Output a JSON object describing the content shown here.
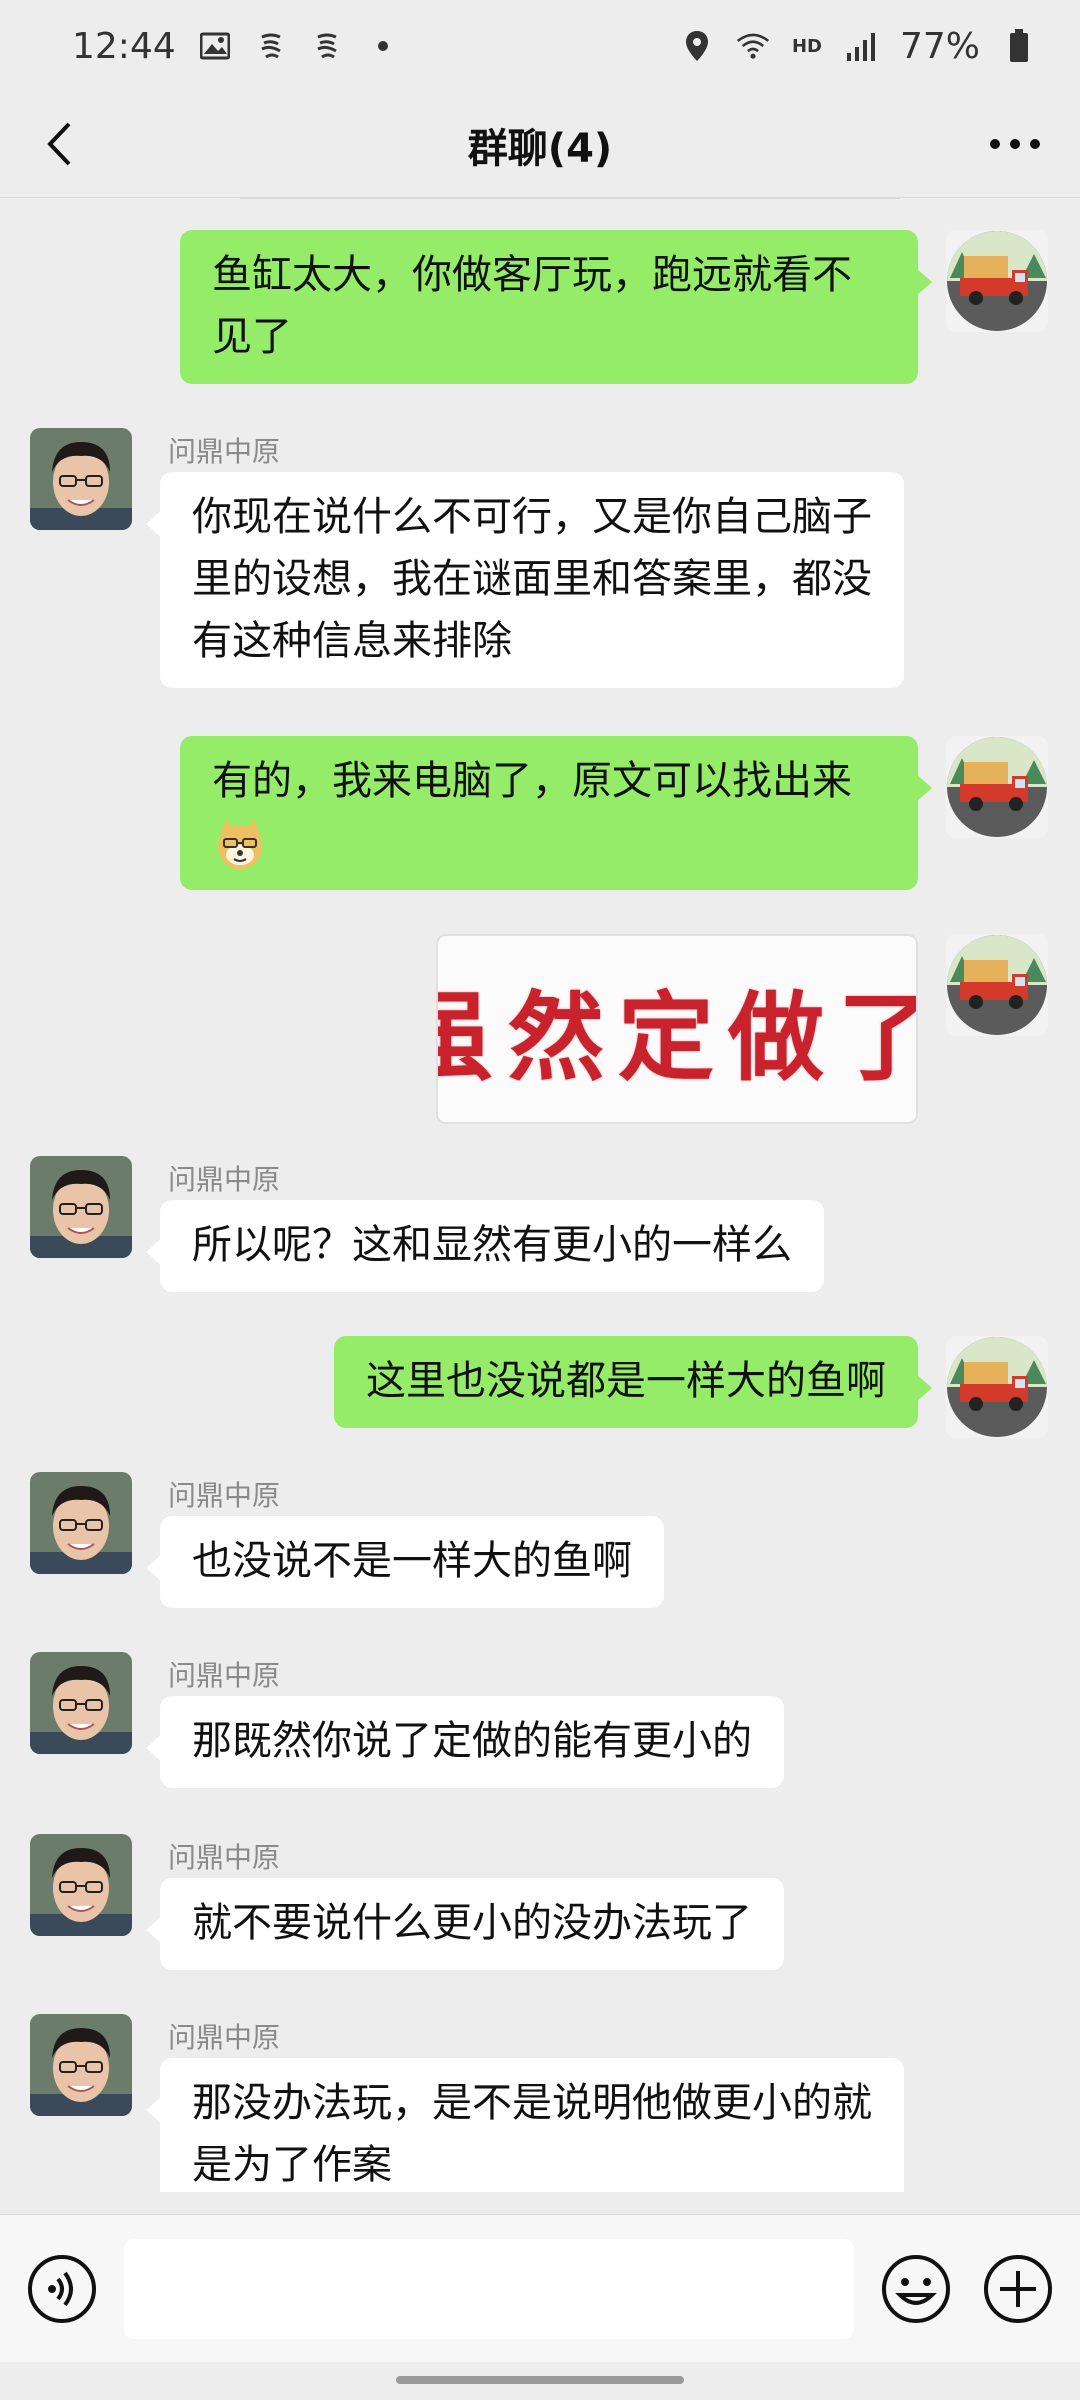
{
  "status_bar": {
    "time": "12:44",
    "hd": "HD",
    "battery": "77%"
  },
  "header": {
    "title": "群聊(4)"
  },
  "messages": [
    {
      "from": "me",
      "text": "鱼缸太大，你做客厅玩，跑远就看不见了"
    },
    {
      "from": "other",
      "sender": "问鼎中原",
      "text": "你现在说什么不可行，又是你自己脑子里的设想，我在谜面里和答案里，都没有这种信息来排除"
    },
    {
      "from": "me",
      "text": "有的，我来电脑了，原文可以找出来"
    },
    {
      "from": "me",
      "type": "image",
      "image_text": "虽然定做了"
    },
    {
      "from": "other",
      "sender": "问鼎中原",
      "text": "所以呢？这和显然有更小的一样么"
    },
    {
      "from": "me",
      "text": "这里也没说都是一样大的鱼啊"
    },
    {
      "from": "other",
      "sender": "问鼎中原",
      "text": "也没说不是一样大的鱼啊"
    },
    {
      "from": "other",
      "sender": "问鼎中原",
      "text": "那既然你说了定做的能有更小的"
    },
    {
      "from": "other",
      "sender": "问鼎中原",
      "text": "就不要说什么更小的没办法玩了"
    },
    {
      "from": "other",
      "sender": "问鼎中原",
      "text": "那没办法玩，是不是说明他做更小的就是为了作案"
    }
  ],
  "input": {
    "placeholder": ""
  },
  "icons": {
    "back": "chevron-left-icon",
    "more": "more-dots-icon",
    "voice": "voice-icon",
    "emoji": "emoji-icon",
    "plus": "plus-icon"
  },
  "colors": {
    "my_bubble": "#95ec69",
    "other_bubble": "#ffffff",
    "background": "#ededed"
  }
}
